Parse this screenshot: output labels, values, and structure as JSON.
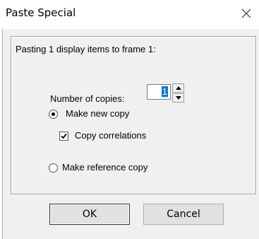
{
  "window": {
    "title": "Paste Special",
    "close_icon": "close-icon"
  },
  "group": {
    "heading": "Pasting 1 display items to frame 1:"
  },
  "copies": {
    "label": "Number of copies:",
    "value": "1"
  },
  "options": {
    "make_new_copy": {
      "label": "Make new copy",
      "selected": true
    },
    "copy_correlations": {
      "label": "Copy correlations",
      "checked": true
    },
    "make_reference_copy": {
      "label": "Make reference copy",
      "selected": false
    }
  },
  "buttons": {
    "ok": "OK",
    "cancel": "Cancel"
  }
}
